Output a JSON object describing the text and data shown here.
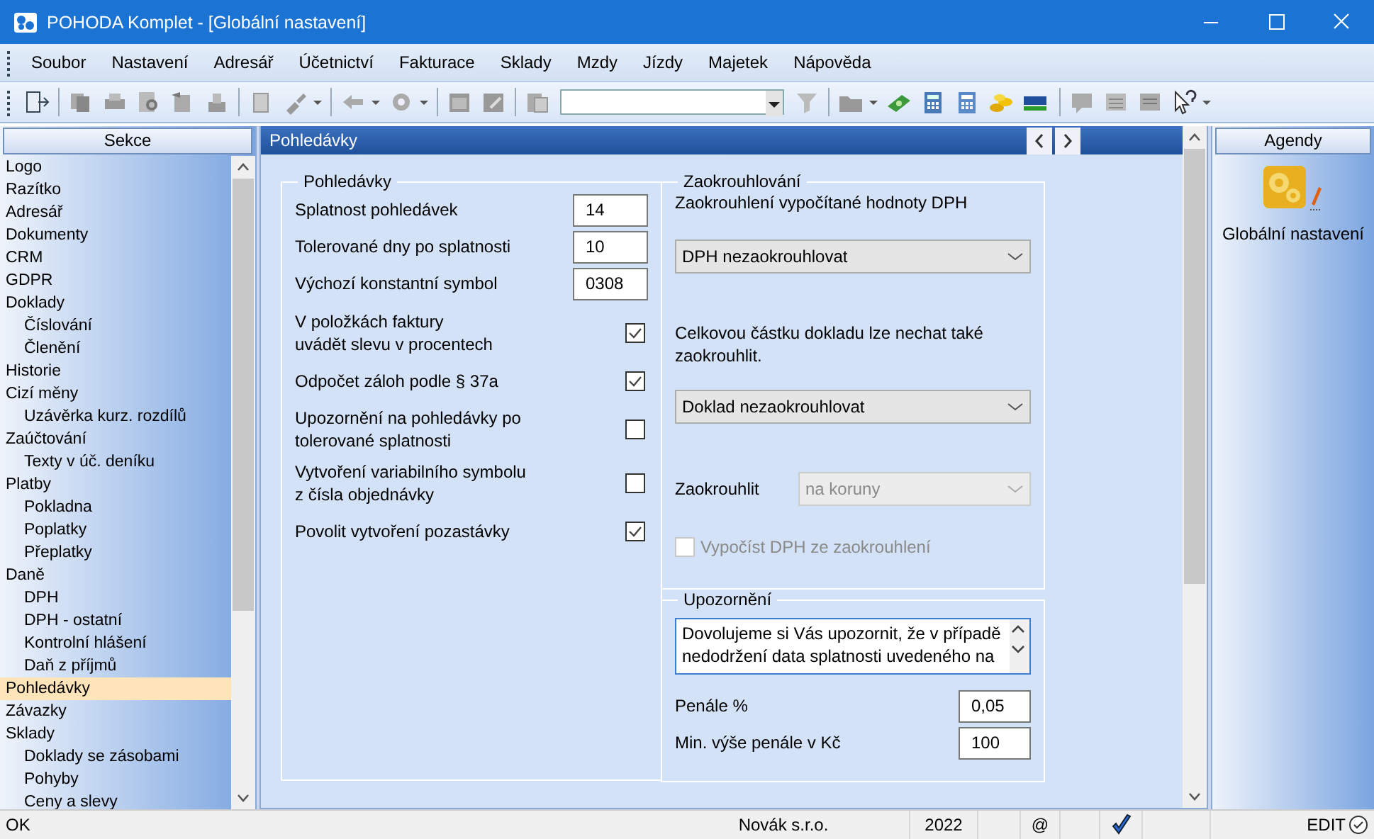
{
  "window": {
    "title": "POHODA Komplet - [Globální nastavení]"
  },
  "menu": [
    "Soubor",
    "Nastavení",
    "Adresář",
    "Účetnictví",
    "Fakturace",
    "Sklady",
    "Mzdy",
    "Jízdy",
    "Majetek",
    "Nápověda"
  ],
  "sections_panel": {
    "title": "Sekce",
    "items": [
      {
        "label": "Logo",
        "selected": false
      },
      {
        "label": "Razítko",
        "selected": false
      },
      {
        "label": "Adresář",
        "selected": false
      },
      {
        "label": "Dokumenty",
        "selected": false
      },
      {
        "label": "CRM",
        "selected": false
      },
      {
        "label": "GDPR",
        "selected": false
      },
      {
        "label": "Doklady",
        "selected": false,
        "children": [
          {
            "label": "Číslování",
            "selected": false
          },
          {
            "label": "Členění",
            "selected": false
          }
        ]
      },
      {
        "label": "Historie",
        "selected": false
      },
      {
        "label": "Cizí měny",
        "selected": false,
        "children": [
          {
            "label": "Uzávěrka kurz. rozdílů",
            "selected": false
          }
        ]
      },
      {
        "label": "Zaúčtování",
        "selected": false,
        "children": [
          {
            "label": "Texty v úč. deníku",
            "selected": false
          }
        ]
      },
      {
        "label": "Platby",
        "selected": false,
        "children": [
          {
            "label": "Pokladna",
            "selected": false
          },
          {
            "label": "Poplatky",
            "selected": false
          },
          {
            "label": "Přeplatky",
            "selected": false
          }
        ]
      },
      {
        "label": "Daně",
        "selected": false,
        "children": [
          {
            "label": "DPH",
            "selected": false
          },
          {
            "label": "DPH - ostatní",
            "selected": false
          },
          {
            "label": "Kontrolní hlášení",
            "selected": false
          },
          {
            "label": "Daň z příjmů",
            "selected": false
          }
        ]
      },
      {
        "label": "Pohledávky",
        "selected": true
      },
      {
        "label": "Závazky",
        "selected": false
      },
      {
        "label": "Sklady",
        "selected": false,
        "children": [
          {
            "label": "Doklady se zásobami",
            "selected": false
          },
          {
            "label": "Pohyby",
            "selected": false
          },
          {
            "label": "Ceny a slevy",
            "selected": false
          }
        ]
      }
    ]
  },
  "page": {
    "title": "Pohledávky",
    "receivables": {
      "title": "Pohledávky",
      "fields": [
        {
          "label": "Splatnost pohledávek",
          "value": "14"
        },
        {
          "label": "Tolerované dny po splatnosti",
          "value": "10"
        },
        {
          "label": "Výchozí konstantní symbol",
          "value": "0308"
        }
      ],
      "options": [
        {
          "lines": [
            "V položkách faktury",
            "uvádět slevu v procentech"
          ],
          "checked": true
        },
        {
          "lines": [
            "Odpočet záloh podle § 37a"
          ],
          "checked": true
        },
        {
          "lines": [
            "Upozornění na pohledávky po",
            "tolerované splatnosti"
          ],
          "checked": false
        },
        {
          "lines": [
            "Vytvoření variabilního symbolu",
            "z čísla objednávky"
          ],
          "checked": false
        },
        {
          "lines": [
            "Povolit vytvoření pozastávky"
          ],
          "checked": true
        }
      ]
    },
    "rounding": {
      "title": "Zaokrouhlování",
      "rows": [
        {
          "kind": "text",
          "text": "Zaokrouhlení vypočítané hodnoty DPH"
        },
        {
          "kind": "select",
          "value": "DPH nezaokrouhlovat",
          "disabled": false
        },
        {
          "kind": "text",
          "text": "Celkovou částku dokladu lze nechat také zaokrouhlit."
        },
        {
          "kind": "select",
          "value": "Doklad nezaokrouhlovat",
          "disabled": false
        },
        {
          "kind": "labeled_select",
          "label": "Zaokrouhlit",
          "value": "na koruny",
          "disabled": true
        },
        {
          "kind": "checkbox",
          "label": "Vypočíst DPH ze zaokrouhlení",
          "checked": false,
          "disabled": true
        }
      ]
    },
    "warning": {
      "title": "Upozornění",
      "message_lines": [
        "Dovolujeme si Vás upozornit, že v případě",
        "nedodržení data splatnosti uvedeného na"
      ],
      "fields": [
        {
          "label": "Penále %",
          "value": "0,05"
        },
        {
          "label": "Min. výše penále v Kč",
          "value": "100"
        }
      ]
    }
  },
  "agendas_panel": {
    "title": "Agendy",
    "items": [
      {
        "label": "Globální nastavení"
      }
    ]
  },
  "status_bar": {
    "message": "OK",
    "company": "Novák s.r.o.",
    "year": "2022",
    "mail": "@",
    "mode": "EDIT"
  }
}
